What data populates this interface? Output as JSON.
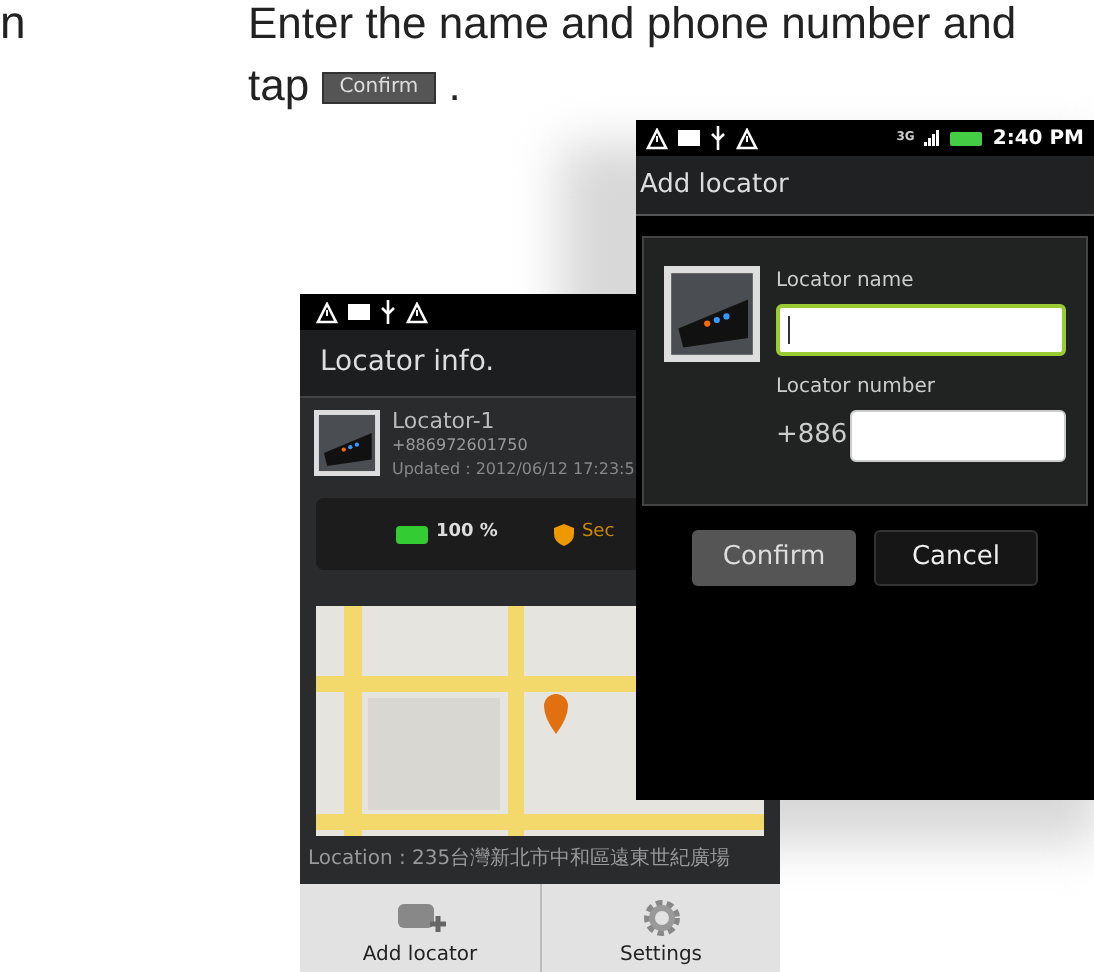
{
  "margin_text": "n",
  "instruction": {
    "text_before": "Enter the name and phone number and tap",
    "inline_button": "Confirm",
    "text_after": "."
  },
  "back_screen": {
    "title": "Locator info.",
    "locator": {
      "name": "Locator-1",
      "number": "+886972601750",
      "updated": "Updated : 2012/06/12 17:23:5"
    },
    "battery": {
      "reading": "100 %",
      "level": 1
    },
    "security": {
      "label": "Sec"
    },
    "location": "Location : 235台灣新北市中和區遠東世紀廣場",
    "toolbar": [
      {
        "label": "Add locator",
        "kind": "add"
      },
      {
        "label": "Settings",
        "kind": "settings"
      }
    ]
  },
  "front_screen": {
    "status_bar": {
      "network": "3G",
      "time": "2:40 PM"
    },
    "title": "Add locator",
    "fields": [
      {
        "label": "Locator name",
        "focused": true
      },
      {
        "label": "Locator number",
        "prefix": "+886",
        "focused": false
      }
    ],
    "buttons": [
      {
        "label": "Confirm",
        "kind": "primary"
      },
      {
        "label": "Cancel",
        "kind": "secondary"
      }
    ]
  }
}
